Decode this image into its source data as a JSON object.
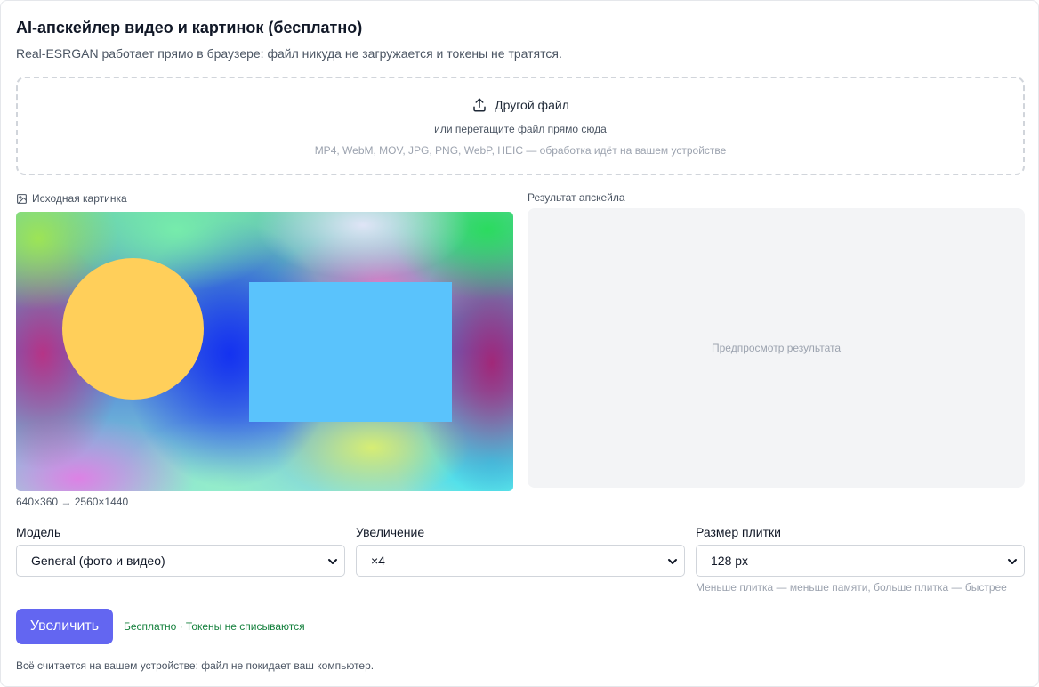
{
  "header": {
    "title": "AI-апскейлер видео и картинок (бесплатно)",
    "subtitle": "Real-ESRGAN работает прямо в браузере: файл никуда не загружается и токены не тратятся."
  },
  "dropzone": {
    "button_label": "Другой файл",
    "button_icon": "upload-icon",
    "hint": "или перетащите файл прямо сюда",
    "formats": "MP4, WebM, MOV, JPG, PNG, WebP, HEIC — обработка идёт на вашем устройстве"
  },
  "source": {
    "label": "Исходная картинка",
    "label_icon": "image-icon",
    "dimensions": "640×360 → 2560×1440"
  },
  "result": {
    "label": "Результат апскейла",
    "placeholder": "Предпросмотр результата"
  },
  "settings": {
    "model": {
      "label": "Модель",
      "value": "General (фото и видео)"
    },
    "scale": {
      "label": "Увеличение",
      "value": "×4"
    },
    "tile": {
      "label": "Размер плитки",
      "value": "128 px",
      "hint": "Меньше плитка — меньше памяти, больше плитка — быстрее"
    }
  },
  "actions": {
    "upscale_label": "Увеличить",
    "free_note": "Бесплатно · Токены не списываются"
  },
  "footer": {
    "note": "Всё считается на вашем устройстве: файл не покидает ваш компьютер."
  },
  "colors": {
    "accent": "#6366f1",
    "success": "#15803d",
    "muted": "#9ca3af"
  }
}
